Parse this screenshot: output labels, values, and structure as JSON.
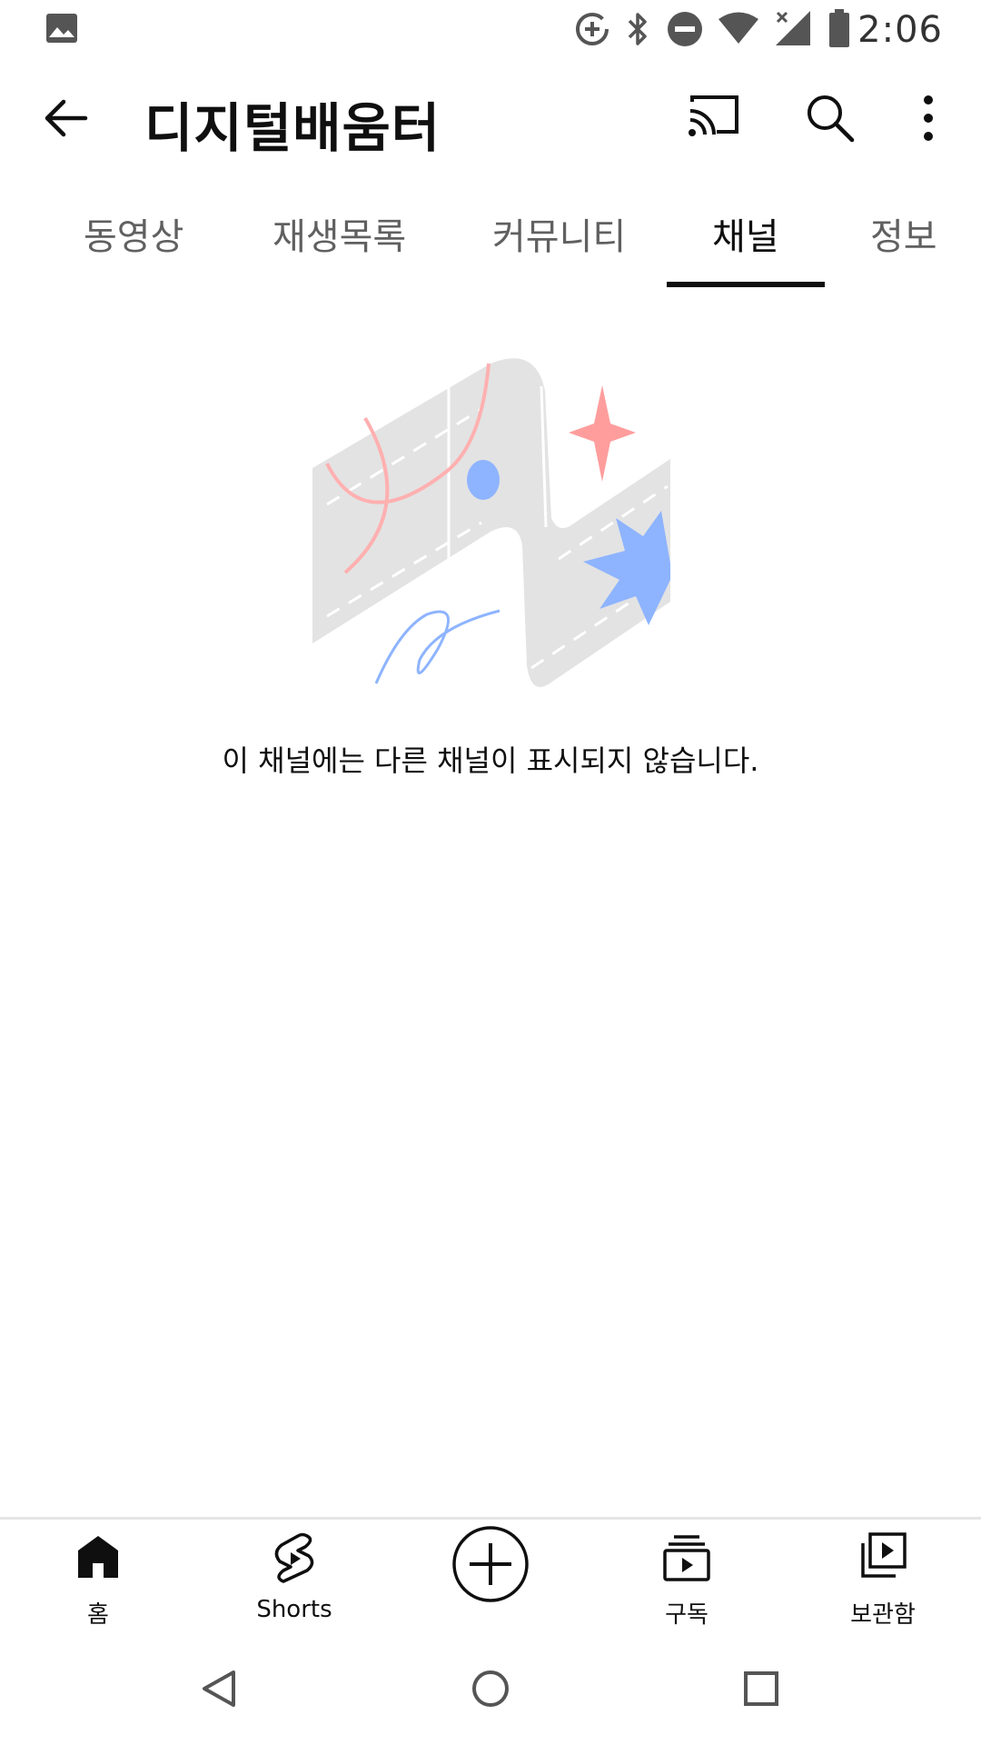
{
  "status_bar": {
    "time": "2:06",
    "icons": [
      "image-icon",
      "data-saver-icon",
      "bluetooth-icon",
      "do-not-disturb-icon",
      "wifi-icon",
      "cellular-no-data-icon",
      "battery-icon"
    ]
  },
  "app_bar": {
    "title": "디지털배움터",
    "icons": [
      "back-arrow-icon",
      "cast-icon",
      "search-icon",
      "more-vert-icon"
    ]
  },
  "tabs": {
    "items": [
      {
        "label": "동영상"
      },
      {
        "label": "재생목록"
      },
      {
        "label": "커뮤니티"
      },
      {
        "label": "채널"
      },
      {
        "label": "정보"
      }
    ],
    "active_index": 3
  },
  "empty_state": {
    "message": "이 채널에는 다른 채널이 표시되지 않습니다.",
    "illustration": "empty-channels-illustration"
  },
  "bottom_nav": {
    "items": [
      {
        "label": "홈",
        "icon": "home-icon"
      },
      {
        "label": "Shorts",
        "icon": "shorts-icon"
      },
      {
        "label": "",
        "icon": "create-plus-icon"
      },
      {
        "label": "구독",
        "icon": "subscriptions-icon"
      },
      {
        "label": "보관함",
        "icon": "library-icon"
      }
    ]
  },
  "system_nav": {
    "icons": [
      "back-triangle-icon",
      "home-circle-icon",
      "recents-square-icon"
    ]
  },
  "colors": {
    "text_primary": "#0f0f0f",
    "text_secondary": "#606060",
    "illustration_gray": "#e3e3e3",
    "illustration_pink": "#ff9d9d",
    "illustration_blue": "#8eb4ff"
  }
}
